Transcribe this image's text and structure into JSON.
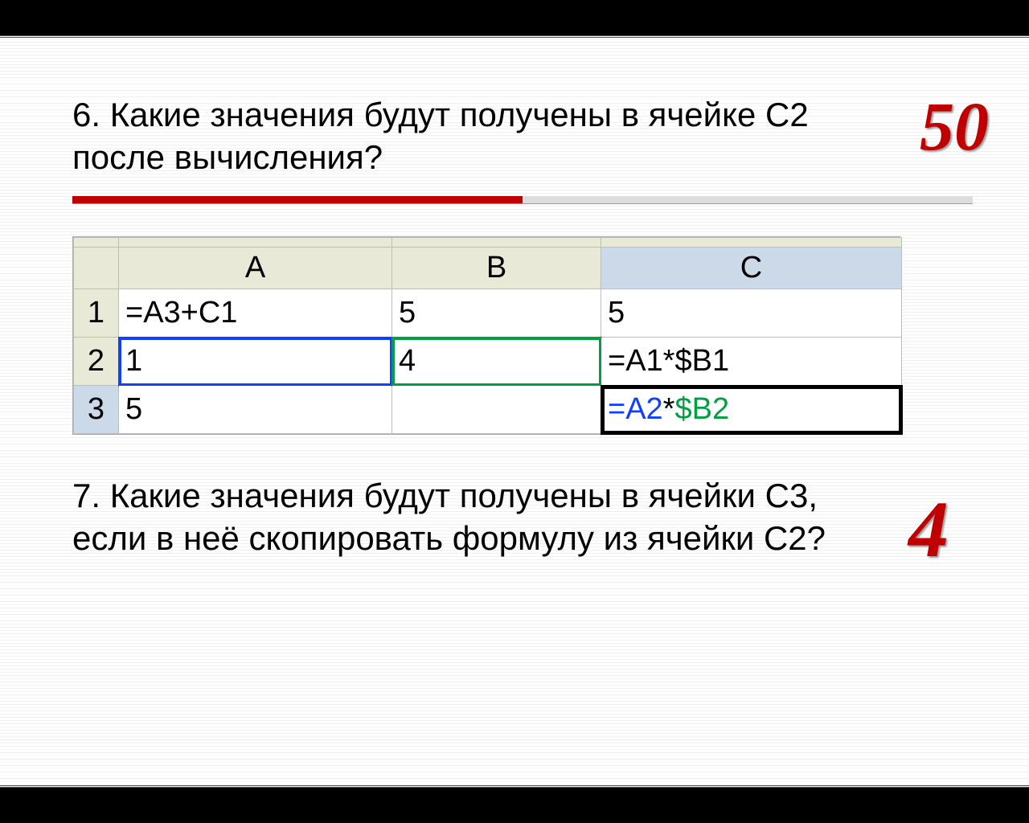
{
  "question6": {
    "text": "6. Какие значения будут получены в ячейке С2 после вычисления?",
    "score": "50"
  },
  "spreadsheet": {
    "headers": {
      "A": "A",
      "B": "B",
      "C": "C"
    },
    "rows": [
      {
        "n": "1",
        "A": "=A3+C1",
        "B": "5",
        "C": "5"
      },
      {
        "n": "2",
        "A": "1",
        "B": "4",
        "C": "=A1*$B1"
      },
      {
        "n": "3",
        "A": "5",
        "B": "",
        "C_refA": "=A2",
        "C_op": "*",
        "C_refB": "$B2"
      }
    ]
  },
  "question7": {
    "text": "7. Какие значения будут получены в ячейки С3, если в неё скопировать формулу из ячейки С2?",
    "score": "4"
  }
}
